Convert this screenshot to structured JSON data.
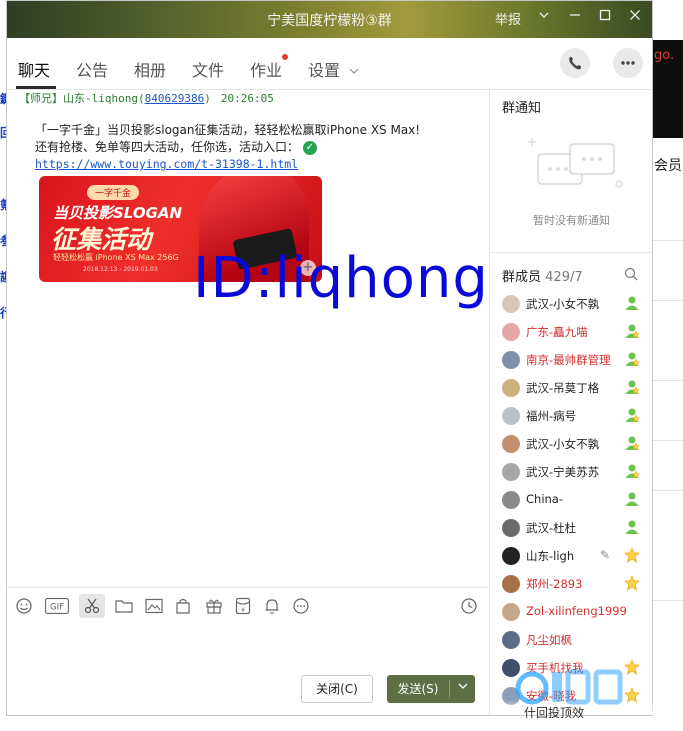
{
  "window": {
    "title": "宁美国度柠檬粉③群",
    "titlebar_menu": "举报"
  },
  "tabs": [
    {
      "label": "聊天",
      "active": true
    },
    {
      "label": "公告"
    },
    {
      "label": "相册"
    },
    {
      "label": "文件"
    },
    {
      "label": "作业",
      "dot": true
    },
    {
      "label": "设置"
    }
  ],
  "message": {
    "sender_tag": "【师兄】",
    "sender_name": "山东-liqhong",
    "sender_id": "840629386",
    "time": "20:26:05",
    "line1": "「一字千金」当贝投影slogan征集活动，轻轻松松赢取iPhone XS Max!",
    "line2": "还有抢楼、免单等四大活动，任你选，活动入口：",
    "url": "https://www.touying.com/t-31398-1.html",
    "banner": {
      "pill": "一字千金",
      "line1": "当贝投影SLOGAN",
      "line2": "征集活动",
      "line3": "轻轻松松赢 iPhone XS Max 256G",
      "line4": "2018.12.13 - 2019.01.03"
    }
  },
  "watermark_text": "ID:liqhong",
  "toolbar": {
    "icons": [
      "smile-icon",
      "gif-icon",
      "scissors-icon",
      "folder-icon",
      "image-icon",
      "shop-icon",
      "gift-icon",
      "red-packet-icon",
      "bell-icon",
      "more-icon",
      "history-icon"
    ],
    "gif_label": "GIF"
  },
  "buttons": {
    "close": "关闭(C)",
    "send": "发送(S)"
  },
  "right_panel": {
    "notice_title": "群通知",
    "notice_empty": "暂时没有新通知",
    "members_title": "群成员",
    "members_count": "429/7",
    "members": [
      {
        "name": "武汉-小女不孰",
        "color": "#222222",
        "badge": "member"
      },
      {
        "name": "广东-矗九喵",
        "color": "#d32f2f",
        "badge": "star-member"
      },
      {
        "name": "南京-最帅群管理",
        "color": "#d32f2f",
        "badge": "star-member"
      },
      {
        "name": "武汉-吊莫丁格",
        "color": "#222222",
        "badge": "star-member"
      },
      {
        "name": "福州-病号",
        "color": "#222222",
        "badge": "star-member"
      },
      {
        "name": "武汉-小女不孰",
        "color": "#222222",
        "badge": "star-member"
      },
      {
        "name": "武汉-宁美苏苏",
        "color": "#222222",
        "badge": "star-member"
      },
      {
        "name": "China-",
        "color": "#222222",
        "badge": "member"
      },
      {
        "name": "武汉-杜杜",
        "color": "#222222",
        "badge": "member"
      },
      {
        "name": "山东-ligh",
        "color": "#222222",
        "badge": "star"
      },
      {
        "name": "郑州-2893",
        "color": "#d32f2f",
        "badge": "star"
      },
      {
        "name": "Zol-xilinfeng1999",
        "color": "#d32f2f",
        "badge": "none"
      },
      {
        "name": "凡尘如枫",
        "color": "#d32f2f",
        "badge": "none"
      },
      {
        "name": "买手机找我",
        "color": "#d32f2f",
        "badge": "star"
      },
      {
        "name": "安徽-晓我",
        "color": "#d32f2f",
        "badge": "star"
      }
    ]
  },
  "background": {
    "right_red_text": "go.",
    "right_text": "会员",
    "footer_text": "什回投顶效"
  }
}
